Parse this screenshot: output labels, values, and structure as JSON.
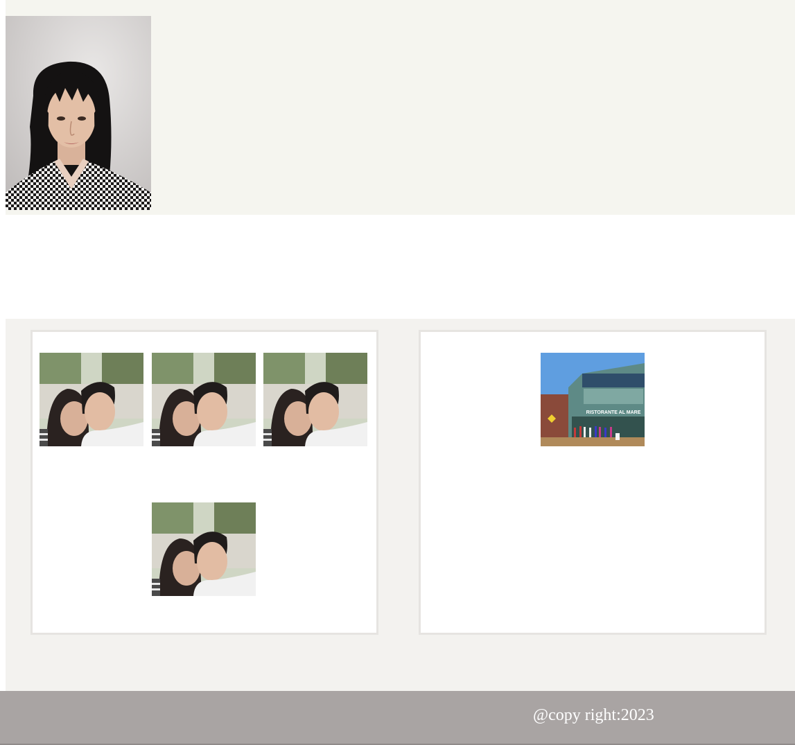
{
  "profile": {
    "photo": "portrait-photo"
  },
  "gallery": {
    "left_card": {
      "photos": [
        "selfie-photo",
        "selfie-photo",
        "selfie-photo",
        "selfie-photo"
      ]
    },
    "right_card": {
      "photos": [
        "restaurant-photo"
      ],
      "sign_text": "RISTORANTE AL MARE"
    }
  },
  "footer": {
    "copyright": "@copy right:2023"
  },
  "colors": {
    "header_bg": "#f5f5ef",
    "gallery_bg": "#f3f2ef",
    "card_border": "#e6e4e1",
    "footer_bg": "#a9a4a3",
    "footer_text": "#ffffff"
  }
}
